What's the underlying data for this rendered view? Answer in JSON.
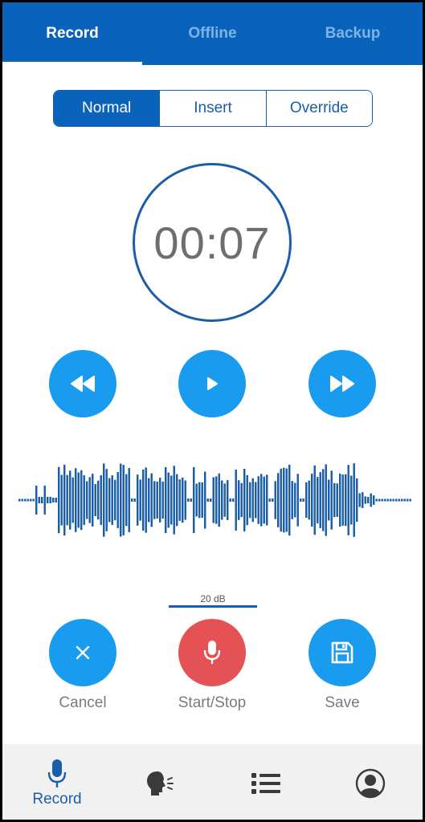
{
  "tabs": [
    {
      "label": "Record",
      "active": true
    },
    {
      "label": "Offline",
      "active": false
    },
    {
      "label": "Backup",
      "active": false
    }
  ],
  "modes": [
    {
      "label": "Normal",
      "active": true
    },
    {
      "label": "Insert",
      "active": false
    },
    {
      "label": "Override",
      "active": false
    }
  ],
  "timer": "00:07",
  "playback": {
    "rewind_icon": "rewind-icon",
    "play_icon": "play-icon",
    "fast_forward_icon": "fast-forward-icon"
  },
  "level_meter": {
    "label": "20 dB"
  },
  "actions": {
    "cancel_label": "Cancel",
    "record_label": "Start/Stop",
    "save_label": "Save"
  },
  "bottom_nav": {
    "record_label": "Record",
    "items": [
      "microphone-icon",
      "speech-icon",
      "list-icon",
      "profile-icon"
    ]
  },
  "colors": {
    "primary": "#0a63bb",
    "accent": "#199bf0",
    "record_red": "#e55255",
    "text_gray": "#7b7b7b"
  }
}
